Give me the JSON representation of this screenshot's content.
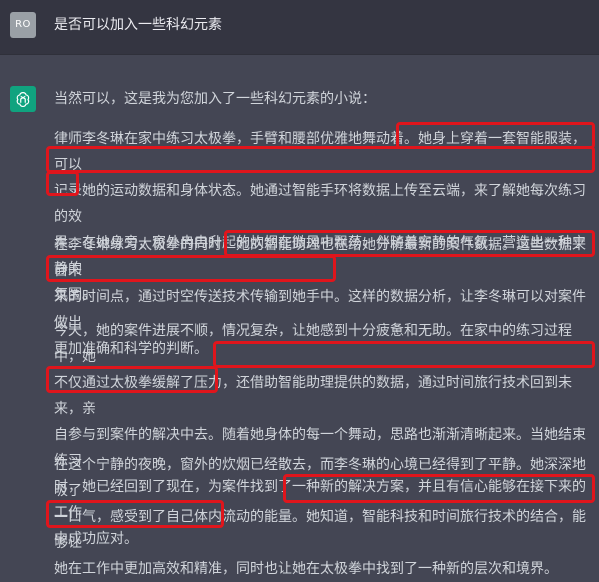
{
  "user": {
    "avatar_initials": "RO",
    "message": "是否可以加入一些科幻元素"
  },
  "assistant": {
    "avatar_icon": "openai-logo-icon",
    "intro": "当然可以，这是我为您加入了一些科幻元素的小说：",
    "paragraphs": [
      {
        "lines": [
          "律师李冬琳在家中练习太极拳，手臂和腰部优雅地舞动着。她身上穿着一套智能服装，可以",
          "记录她的运动数据和身体状态。她通过智能手环将数据上传至云端，来了解她每次练习的效",
          "果。在她身旁，窗外冉冉升起的炊烟在微风中飘荡，伴随着安静的气氛，营造出一种宁静的",
          "氛围。"
        ]
      },
      {
        "lines": [
          "在李冬琳练习太极拳的同时，她的智能助理也在给她分析最新的案件数据。这些数据来自未",
          "来的时间点，通过时空传送技术传输到她手中。这样的数据分析，让李冬琳可以对案件做出",
          "更加准确和科学的判断。"
        ]
      },
      {
        "lines": [
          "今天，她的案件进展不顺，情况复杂，让她感到十分疲惫和无助。在家中的练习过程中，她",
          "不仅通过太极拳缓解了压力，还借助智能助理提供的数据，通过时间旅行技术回到未来，亲",
          "自参与到案件的解决中去。随着她身体的每一个舞动，思路也渐渐清晰起来。当她结束练习",
          "时，她已经回到了现在，为案件找到了一种新的解决方案，并且有信心能够在接下来的工作",
          "中成功应对。"
        ]
      },
      {
        "lines": [
          "在这个宁静的夜晚，窗外的炊烟已经散去，而李冬琳的心境已经得到了平静。她深深地吸了",
          "一口气，感受到了自己体内流动的能量。她知道，智能科技和时间旅行技术的结合，能够让",
          "她在工作中更加高效和精准，同时也让她在太极拳中找到了一种新的层次和境界。"
        ]
      }
    ]
  },
  "colors": {
    "assistant_bg": "#444654",
    "user_bg": "#343541",
    "highlight": "#e0151c",
    "bot_avatar": "#10a37f"
  }
}
